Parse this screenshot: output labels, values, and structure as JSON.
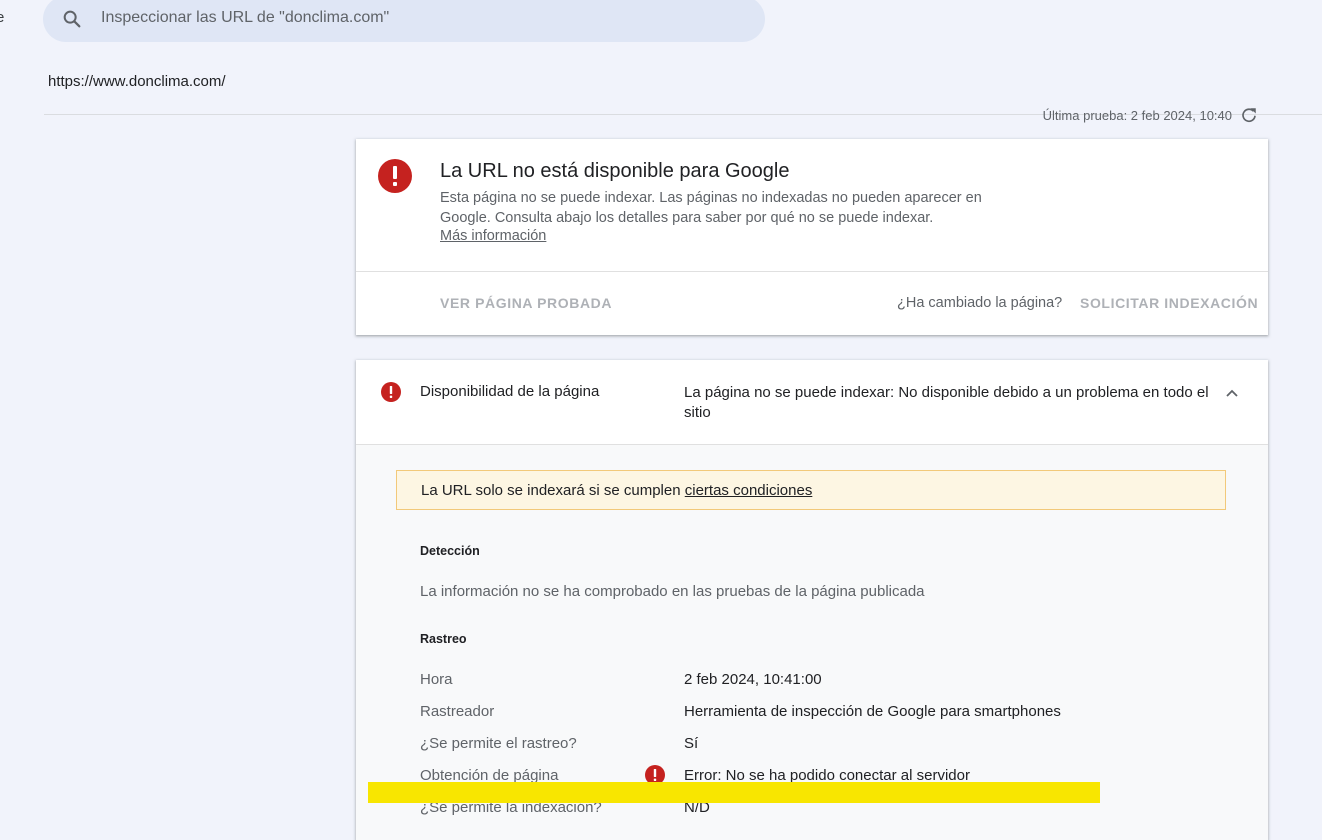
{
  "edge_char": "e",
  "search": {
    "placeholder": "Inspeccionar las URL de \"donclima.com\"",
    "icon": "search-icon"
  },
  "inspected_url": "https://www.donclima.com/",
  "last_test": {
    "label": "Última prueba: 2 feb 2024, 10:40",
    "icon": "refresh-icon"
  },
  "summary_card": {
    "icon": "error-icon",
    "title": "La URL no está disponible para Google",
    "description": "Esta página no se puede indexar. Las páginas no indexadas no pueden aparecer en Google. Consulta abajo los detalles para saber por qué no se puede indexar.",
    "more_link": "Más información",
    "view_tested_button": "VER PÁGINA PROBADA",
    "changed_question": "¿Ha cambiado la página?",
    "request_indexing_button": "SOLICITAR INDEXACIÓN"
  },
  "availability_card": {
    "icon": "error-icon",
    "label": "Disponibilidad de la página",
    "value": "La página no se puede indexar: No disponible debido a un problema en todo el sitio",
    "chevron_icon": "chevron-up-icon",
    "notice_text": "La URL solo se indexará si se cumplen",
    "notice_link": "ciertas condiciones",
    "detection": {
      "heading": "Detección",
      "info": "La información no se ha comprobado en las pruebas de la página publicada"
    },
    "crawl": {
      "heading": "Rastreo",
      "rows": [
        {
          "label": "Hora",
          "value": "2 feb 2024, 10:41:00"
        },
        {
          "label": "Rastreador",
          "value": "Herramienta de inspección de Google para smartphones"
        },
        {
          "label": "¿Se permite el rastreo?",
          "value": "Sí"
        },
        {
          "label": "Obtención de página",
          "value": "Error: No se ha podido conectar al servidor",
          "status": "error"
        },
        {
          "label": "¿Se permite la indexación?",
          "value": "N/D"
        }
      ]
    }
  },
  "colors": {
    "error": "#c5221f",
    "highlight": "#f8e600",
    "notice_bg": "#fdf6e3",
    "notice_border": "#f2c97a"
  }
}
